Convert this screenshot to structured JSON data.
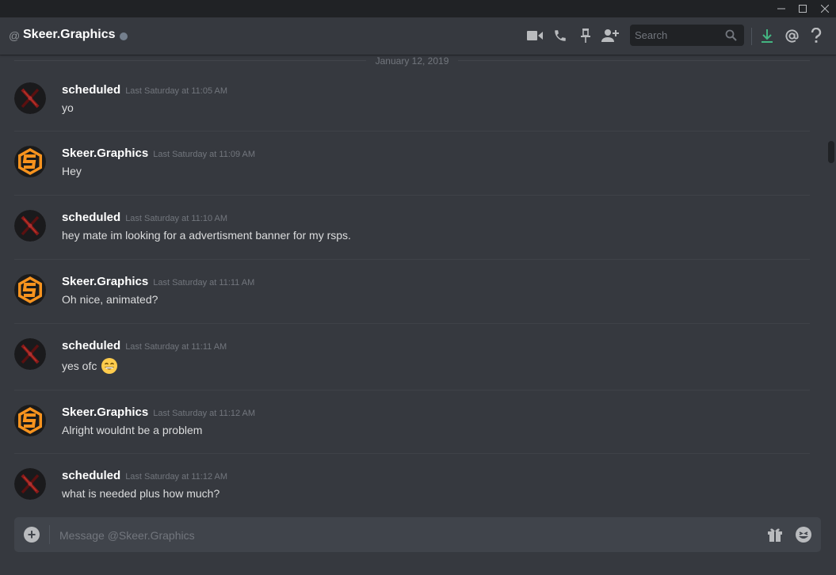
{
  "window": {
    "controls": [
      "minimize-icon",
      "maximize-icon",
      "close-icon"
    ]
  },
  "header": {
    "at_symbol": "@",
    "channel_name": "Skeer.Graphics",
    "status": "offline",
    "icons": [
      "video-call-icon",
      "phone-call-icon",
      "pin-icon",
      "add-friend-icon",
      "download-icon",
      "mention-icon",
      "help-icon"
    ],
    "search": {
      "placeholder": "Search"
    }
  },
  "date_divider": "January 12, 2019",
  "messages": [
    {
      "author": "scheduled",
      "timestamp": "Last Saturday at 11:05 AM",
      "text": "yo",
      "avatar": "x-logo-avatar"
    },
    {
      "author": "Skeer.Graphics",
      "timestamp": "Last Saturday at 11:09 AM",
      "text": "Hey",
      "avatar": "s-logo-avatar"
    },
    {
      "author": "scheduled",
      "timestamp": "Last Saturday at 11:10 AM",
      "text": "hey mate im looking for a advertisment banner for my rsps.",
      "avatar": "x-logo-avatar"
    },
    {
      "author": "Skeer.Graphics",
      "timestamp": "Last Saturday at 11:11 AM",
      "text": "Oh nice, animated?",
      "avatar": "s-logo-avatar"
    },
    {
      "author": "scheduled",
      "timestamp": "Last Saturday at 11:11 AM",
      "text": "yes ofc",
      "emoji": "grinning-face-emoji",
      "avatar": "x-logo-avatar"
    },
    {
      "author": "Skeer.Graphics",
      "timestamp": "Last Saturday at 11:12 AM",
      "text": "Alright wouldnt be a problem",
      "avatar": "s-logo-avatar"
    },
    {
      "author": "scheduled",
      "timestamp": "Last Saturday at 11:12 AM",
      "text": "what is needed plus how much?",
      "avatar": "x-logo-avatar"
    }
  ],
  "composer": {
    "placeholder": "Message @Skeer.Graphics",
    "icons": [
      "add-attachment-icon",
      "gift-icon",
      "emoji-picker-icon"
    ]
  },
  "colors": {
    "background": "#36393f",
    "titlebar": "#202225",
    "composer": "#40444b",
    "text": "#dcddde",
    "muted": "#72767d",
    "download_accent": "#43b581",
    "avatar_orange": "#f7931e"
  }
}
